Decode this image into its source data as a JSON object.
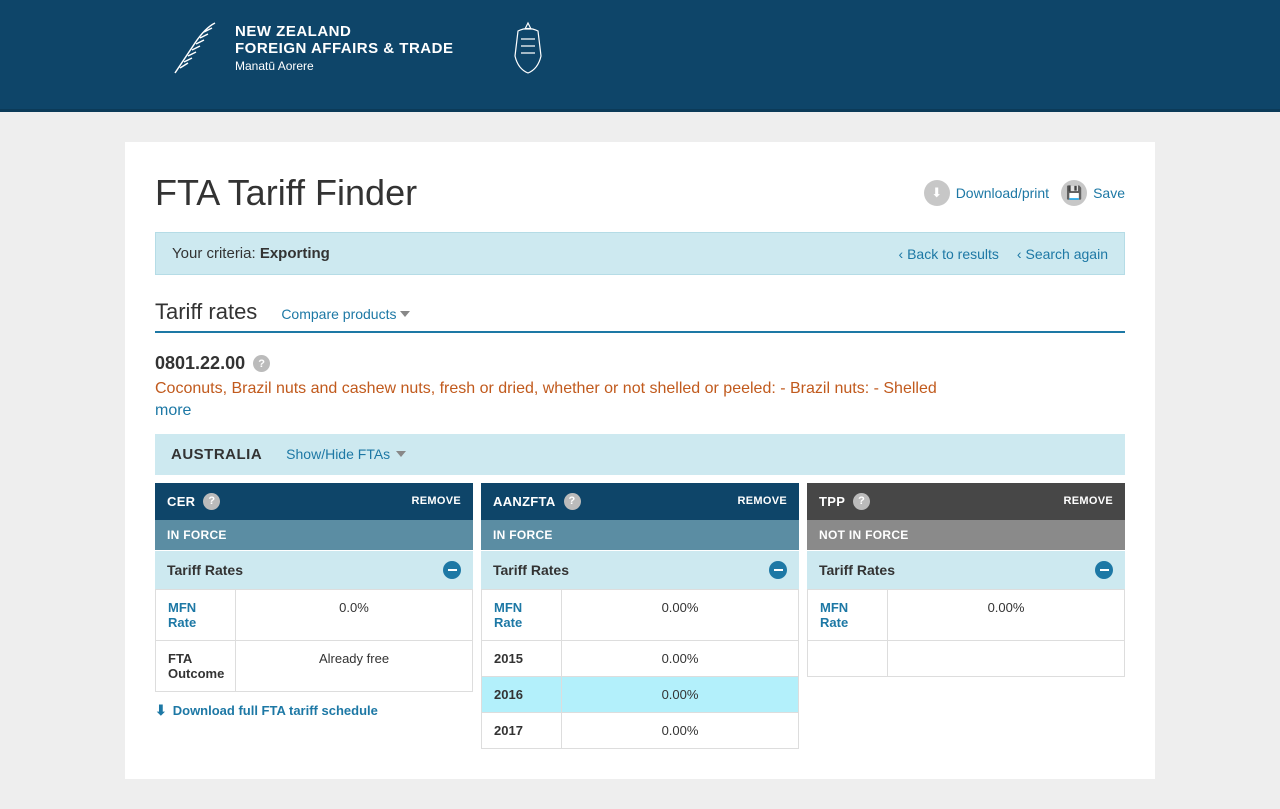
{
  "header": {
    "org_line1": "NEW ZEALAND",
    "org_line2": "FOREIGN AFFAIRS & TRADE",
    "org_line3": "Manatū Aorere"
  },
  "page": {
    "title": "FTA Tariff Finder",
    "download_label": "Download/print",
    "save_label": "Save"
  },
  "criteria": {
    "label": "Your criteria: ",
    "value": "Exporting",
    "back_results": "Back to results",
    "search_again": "Search again"
  },
  "section": {
    "tariff_rates": "Tariff rates",
    "compare": "Compare products"
  },
  "product": {
    "code": "0801.22.00",
    "description": "Coconuts, Brazil nuts and cashew nuts, fresh or dried, whether or not shelled or peeled: - Brazil nuts: - Shelled",
    "more": "more"
  },
  "country": {
    "name": "AUSTRALIA",
    "show_hide": "Show/Hide FTAs"
  },
  "labels": {
    "remove": "REMOVE",
    "in_force": "IN FORCE",
    "not_in_force": "NOT IN FORCE",
    "tariff_rates": "Tariff Rates",
    "mfn_rate": "MFN Rate",
    "fta_outcome": "FTA Outcome",
    "download_schedule": "Download full FTA tariff schedule"
  },
  "cols": {
    "cer": {
      "name": "CER",
      "status": "IN FORCE",
      "mfn": "0.0%",
      "outcome": "Already free"
    },
    "aanzfta": {
      "name": "AANZFTA",
      "status": "IN FORCE",
      "mfn": "0.00%",
      "rows": [
        {
          "year": "2015",
          "value": "0.00%"
        },
        {
          "year": "2016",
          "value": "0.00%"
        },
        {
          "year": "2017",
          "value": "0.00%"
        }
      ]
    },
    "tpp": {
      "name": "TPP",
      "status": "NOT IN FORCE",
      "mfn": "0.00%"
    }
  }
}
